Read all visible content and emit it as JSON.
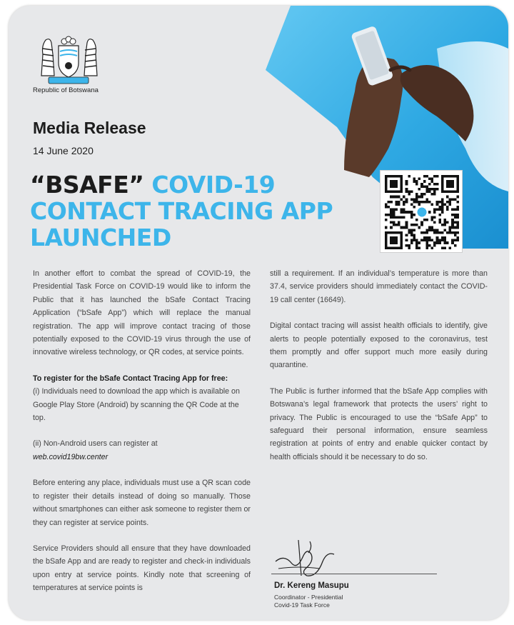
{
  "header": {
    "republic": "Republic of Botswana",
    "media_title": "Media Release",
    "date": "14 June 2020"
  },
  "headline": {
    "part1": "“BSAFE”",
    "part2": "COVID-19",
    "line2": "CONTACT TRACING APP",
    "line3": "LAUNCHED"
  },
  "left_column": {
    "p1": "In another effort to combat the spread of COVID-19, the Presidential Task Force on COVID-19 would like to inform the Public that it has launched the bSafe Contact Tracing Application (“bSafe App”) which will replace the manual registration. The app will improve contact tracing of those potentially exposed to the COVID-19 virus through the use of innovative wireless technology, or QR codes, at service points.",
    "register_heading": "To register for the bSafe Contact Tracing App for free:",
    "register_i": "(i) Individuals need to download the app which is available on Google Play Store (Android) by scanning the QR Code at the top.",
    "register_ii": "(ii) Non-Android users can register at",
    "web": "web.covid19bw.center",
    "p3": "Before entering any place, individuals must use a QR scan code to register their details instead of doing so manually. Those without smartphones can either ask someone to register them or they can register at service points.",
    "p4": "Service Providers should all ensure that they have downloaded the bSafe App and are ready to register and check-in individuals upon entry at service points. Kindly note that screening of temperatures at service points is"
  },
  "right_column": {
    "p1": "still a requirement. If an individual’s temperature is more than 37.4, service providers should immediately contact the COVID-19 call center (16649).",
    "p2": "Digital contact tracing will assist health officials to identify, give alerts to people potentially exposed to the coronavirus, test them promptly and offer support much more easily during quarantine.",
    "p3": "The Public is further informed that the bSafe App complies with Botswana’s legal framework that protects the users’ right to privacy. The Public is encouraged to use the “bSafe App” to safeguard their personal information, ensure seamless registration at points of entry and enable quicker contact by health officials should it be necessary to do so."
  },
  "signatory": {
    "name": "Dr. Kereng Masupu",
    "role_line1": "Coordinator - Presidential",
    "role_line2": "Covid-19 Task Force"
  },
  "colors": {
    "accent_blue": "#3db5ea",
    "card_bg": "#e7e8ea",
    "heading_dark": "#1c1c1c"
  },
  "icons": {
    "coat_of_arms": "botswana-coat-of-arms",
    "qr": "qr-code",
    "hero": "hands-holding-phone-photo"
  }
}
